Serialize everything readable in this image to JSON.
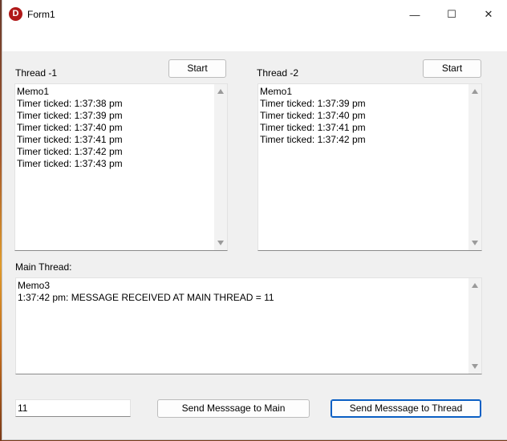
{
  "window": {
    "title": "Form1",
    "icon_letter": "D",
    "controls": {
      "minimize": "—",
      "maximize": "☐",
      "close": "✕"
    }
  },
  "thread1": {
    "label": "Thread -1",
    "start_label": "Start",
    "memo_lines": [
      "Memo1",
      "Timer ticked: 1:37:38 pm",
      "Timer ticked: 1:37:39 pm",
      "Timer ticked: 1:37:40 pm",
      "Timer ticked: 1:37:41 pm",
      "Timer ticked: 1:37:42 pm",
      "Timer ticked: 1:37:43 pm"
    ]
  },
  "thread2": {
    "label": "Thread -2",
    "start_label": "Start",
    "memo_lines": [
      "Memo1",
      "Timer ticked: 1:37:39 pm",
      "Timer ticked: 1:37:40 pm",
      "Timer ticked: 1:37:41 pm",
      "Timer ticked: 1:37:42 pm"
    ]
  },
  "main_thread": {
    "label": "Main Thread:",
    "memo_lines": [
      "Memo3",
      "1:37:42 pm: MESSAGE RECEIVED AT MAIN THREAD = 11"
    ]
  },
  "footer": {
    "input_value": "11",
    "send_main_label": "Send Messsage to Main",
    "send_thread_label": "Send Messsage to Thread"
  }
}
